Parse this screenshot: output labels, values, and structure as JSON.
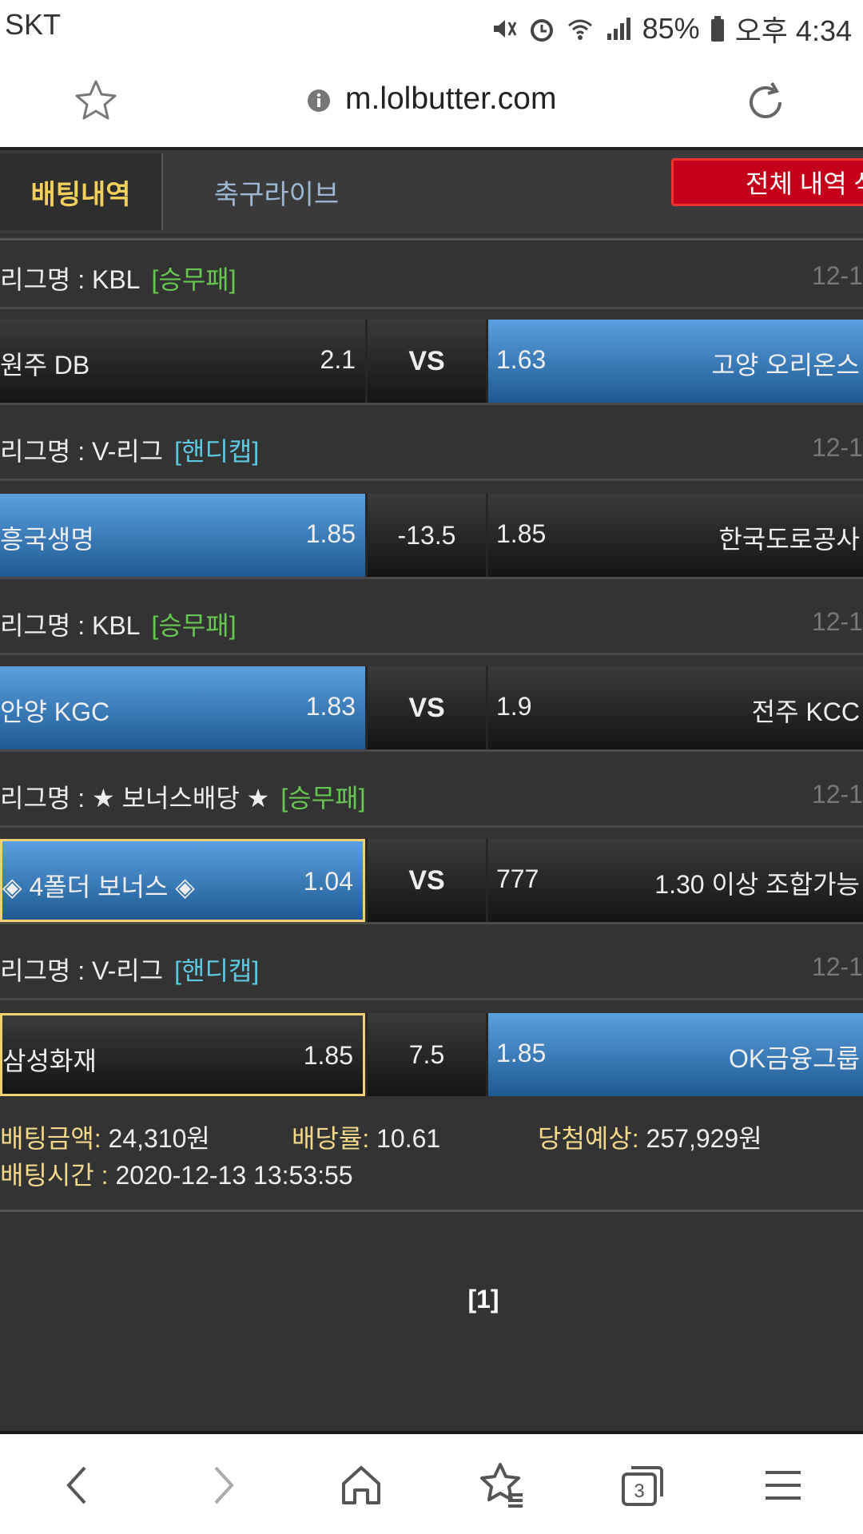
{
  "status_bar": {
    "carrier": "SKT",
    "battery": "85%",
    "time": "오후 4:34"
  },
  "browser": {
    "url": "m.lolbutter.com"
  },
  "tabs": {
    "active": "배팅내역",
    "inactive": "축구라이브",
    "delete_button": "전체 내역 삭제"
  },
  "bets": [
    {
      "league": "리그명 : KBL",
      "type": "[승무패]",
      "type_color": "#66c850",
      "date": "12-1",
      "left_team": "원주 DB",
      "left_odds": "2.1",
      "middle": "VS",
      "right_odds": "1.63",
      "right_team": "고양 오리온스",
      "selected": "right"
    },
    {
      "league": "리그명 : V-리그",
      "type": "[핸디캡]",
      "type_color": "#5cc9e0",
      "date": "12-1",
      "left_team": "흥국생명",
      "left_odds": "1.85",
      "middle": "-13.5",
      "right_odds": "1.85",
      "right_team": "한국도로공사",
      "selected": "left"
    },
    {
      "league": "리그명 : KBL",
      "type": "[승무패]",
      "type_color": "#66c850",
      "date": "12-1",
      "left_team": "안양 KGC",
      "left_odds": "1.83",
      "middle": "VS",
      "right_odds": "1.9",
      "right_team": "전주 KCC",
      "selected": "left"
    },
    {
      "league": "리그명 : ★ 보너스배당 ★",
      "type": "[승무패]",
      "type_color": "#66c850",
      "date": "12-1",
      "left_team": "◈ 4폴더 보너스 ◈",
      "left_odds": "1.04",
      "middle": "VS",
      "right_odds": "777",
      "right_team": "1.30 이상 조합가능",
      "selected": "left"
    },
    {
      "league": "리그명 : V-리그",
      "type": "[핸디캡]",
      "type_color": "#5cc9e0",
      "date": "12-1",
      "left_team": "삼성화재",
      "left_odds": "1.85",
      "middle": "7.5",
      "right_odds": "1.85",
      "right_team": "OK금융그룹",
      "selected": "right"
    }
  ],
  "summary": {
    "amount_label": "배팅금액:",
    "amount": " 24,310원",
    "rate_label": "배당률:",
    "rate": " 10.61",
    "win_label": "당첨예상:",
    "win": " 257,929원",
    "time_label": "배팅시간 :",
    "time": " 2020-12-13 13:53:55"
  },
  "pagination": "[1]",
  "icons": [
    "star-icon",
    "info-icon",
    "reload-icon",
    "back-icon",
    "forward-icon",
    "home-icon",
    "bookmarks-icon",
    "tabs-icon",
    "menu-icon"
  ],
  "tab_count": "3"
}
